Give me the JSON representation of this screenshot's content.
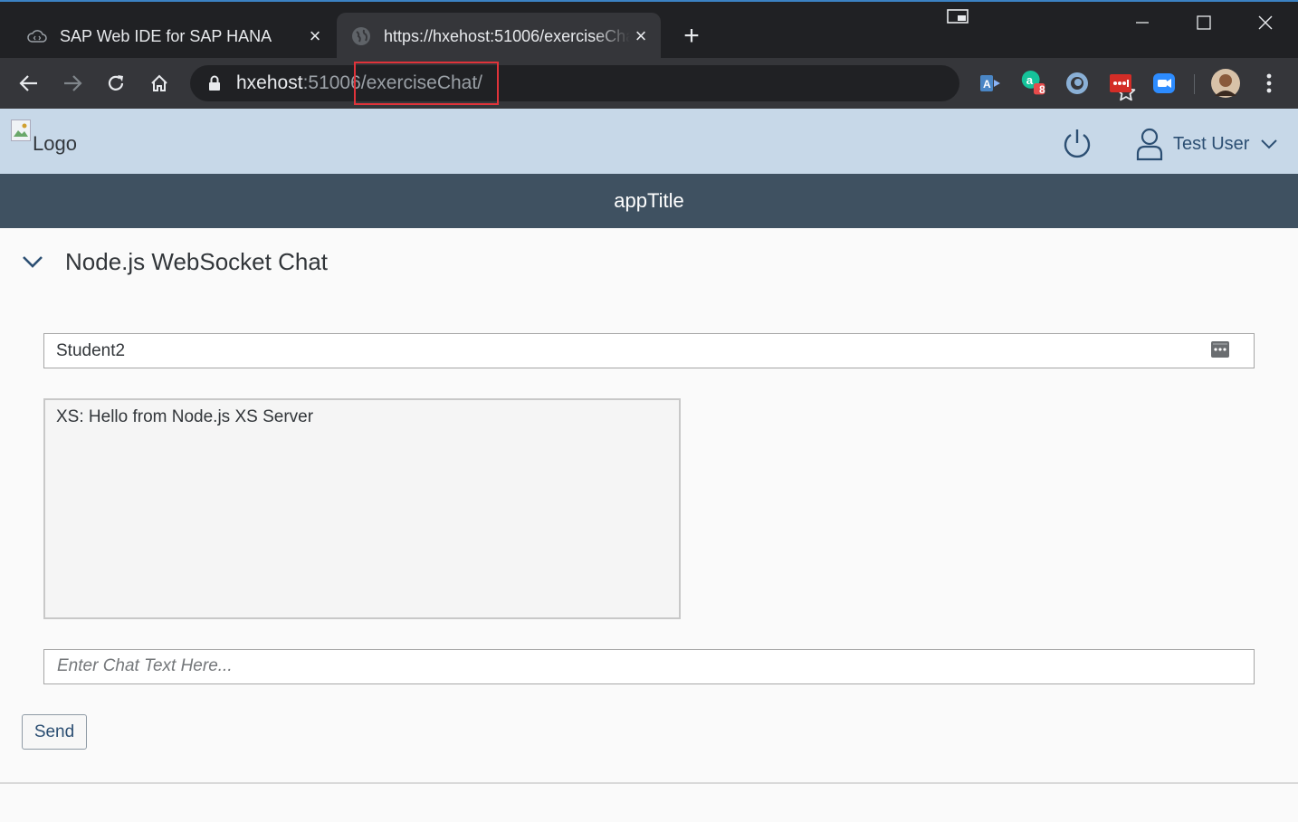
{
  "browser": {
    "tabs": [
      {
        "title": "SAP Web IDE for SAP HANA",
        "active": false,
        "favicon": "cloud-code-icon"
      },
      {
        "title": "https://hxehost:51006/exerciseChat/",
        "active": true,
        "favicon": "globe-icon"
      }
    ],
    "url": {
      "host": "hxehost",
      "port": ":51006",
      "path": "/exerciseChat/"
    },
    "extension_badge": "8"
  },
  "shell": {
    "logo_alt": "Logo",
    "user_name": "Test User"
  },
  "app": {
    "title": "appTitle",
    "panel_title": "Node.js WebSocket Chat",
    "user_field_value": "Student2",
    "chat_log": "XS: Hello from Node.js XS Server",
    "chat_placeholder": "Enter Chat Text Here...",
    "send_label": "Send"
  },
  "colors": {
    "shell_bg": "#c7d8e8",
    "title_bar": "#3f5161",
    "highlight_box": "#e0333a"
  }
}
